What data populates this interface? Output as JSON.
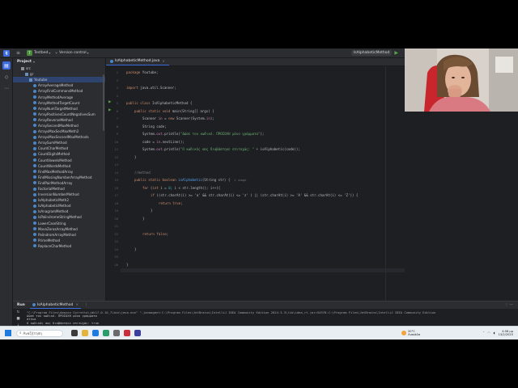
{
  "titlebar": {
    "project_badge": "T",
    "project_name": "Testbed",
    "vcs_label": "Version control",
    "run_config": "IsAlphabeticMethod"
  },
  "project_panel": {
    "title": "Project",
    "items": [
      {
        "label": "src",
        "kind": "folder",
        "indent": 2
      },
      {
        "label": "gr",
        "kind": "pkg",
        "indent": 3
      },
      {
        "label": "Youtube",
        "kind": "pkg",
        "indent": 4,
        "selected": true
      },
      {
        "label": "ArrayAverageMethod",
        "kind": "class",
        "indent": 5
      },
      {
        "label": "ArrayFindCommonsMethod",
        "kind": "class",
        "indent": 5
      },
      {
        "label": "ArrayMethodAverage",
        "kind": "class",
        "indent": 5
      },
      {
        "label": "ArrayMethodTargetCount",
        "kind": "class",
        "indent": 5
      },
      {
        "label": "ArrayNumTargetMethod",
        "kind": "class",
        "indent": 5
      },
      {
        "label": "ArrayPositivesCountNegativesSum",
        "kind": "class",
        "indent": 5
      },
      {
        "label": "ArrayReverseMethod",
        "kind": "class",
        "indent": 5
      },
      {
        "label": "ArraySecondMaxMethod",
        "kind": "class",
        "indent": 5
      },
      {
        "label": "ArraysMaxSecMaxMeth2",
        "kind": "class",
        "indent": 5
      },
      {
        "label": "ArraysMaxSecondMaxMethods",
        "kind": "class",
        "indent": 5
      },
      {
        "label": "ArraySumMethod",
        "kind": "class",
        "indent": 5
      },
      {
        "label": "CountCharMethod",
        "kind": "class",
        "indent": 5
      },
      {
        "label": "CountDigitsMethod",
        "kind": "class",
        "indent": 5
      },
      {
        "label": "CountVowelsMethod",
        "kind": "class",
        "indent": 5
      },
      {
        "label": "CountWordsMethod",
        "kind": "class",
        "indent": 5
      },
      {
        "label": "FindMaxMethodArray",
        "kind": "class",
        "indent": 5
      },
      {
        "label": "FindMissingNumberArrayMethod",
        "kind": "class",
        "indent": 5
      },
      {
        "label": "FindPairMethodArray",
        "kind": "class",
        "indent": 5
      },
      {
        "label": "FactorialMethod",
        "kind": "class",
        "indent": 5
      },
      {
        "label": "InversionNumberMethod",
        "kind": "class",
        "indent": 5
      },
      {
        "label": "IsAlphabeticMeth2",
        "kind": "class",
        "indent": 5
      },
      {
        "label": "IsAlphabeticMethod",
        "kind": "class",
        "indent": 5
      },
      {
        "label": "IsAnagramMethod",
        "kind": "class",
        "indent": 5
      },
      {
        "label": "IsPalindromeStringMethod",
        "kind": "class",
        "indent": 5
      },
      {
        "label": "LowerCaseString",
        "kind": "class",
        "indent": 5
      },
      {
        "label": "MoveZerosArrayMethod",
        "kind": "class",
        "indent": 5
      },
      {
        "label": "PalindromArrayMethod",
        "kind": "class",
        "indent": 5
      },
      {
        "label": "PrimeMethod",
        "kind": "class",
        "indent": 5
      },
      {
        "label": "ReplaceCharMethod",
        "kind": "class",
        "indent": 5
      }
    ]
  },
  "editor": {
    "tab_label": "IsAlphabeticMethod.java",
    "line_numbers": [
      "1",
      "2",
      "3",
      "4",
      "5",
      "6",
      "7",
      "8",
      "9",
      "10",
      "11",
      "12",
      "13",
      "14",
      "15",
      "16",
      "17",
      "18",
      "19",
      "20",
      "21",
      "22",
      "23",
      "24",
      "25",
      "26"
    ],
    "code": {
      "l1_kw": "package",
      "l1_rest": " Youtube;",
      "l3_kw": "import",
      "l3_rest": " java.util.Scanner;",
      "l5_kw": "public class",
      "l5_rest": " IsAlphabeticMethod {",
      "l6_kw": "public static void",
      "l6_rest": " main(String[] args) {",
      "l7_a": "Scanner ",
      "l7_b": "in",
      "l7_c": " = ",
      "l7_kw": "new",
      "l7_d": " Scanner(System.",
      "l7_e": "in",
      "l7_f": ");",
      "l8": "String code;",
      "l9_a": "System.",
      "l9_b": "out",
      "l9_c": ".println(",
      "l9_str": "\"Δώσε τον κωδικό. ΠΡΟΣΟΧΗ μόνο γράμματα\"",
      "l9_d": ");",
      "l10_a": "code = ",
      "l10_b": "in",
      "l10_c": ".nextLine();",
      "l11_a": "System.",
      "l11_b": "out",
      "l11_c": ".println(",
      "l11_str": "\"O κωδικός σας διαβάστηκε επιτυχώς: \"",
      "l11_d": " + isAlphabetic(code));",
      "l12": "}",
      "l14": "//method",
      "l15_kw": "public static boolean",
      "l15_fn": " isAlphabetic",
      "l15_rest": "(String str) {",
      "l15_hint": "1 usage",
      "l16_kw": "for",
      "l16_a": " (",
      "l16_kw2": "int",
      "l16_b": " i = ",
      "l16_n": "0",
      "l16_c": "; i < str.length(); i++){",
      "l17_kw": "if",
      "l17_rest": " ((str.charAt(i) >= 'a' && str.charAt(i) <= 'z' ) || (str.charAt(i) >= 'A' && str.charAt(i) <= 'Z')) {",
      "l18_kw": "return true",
      "l18_rest": ";",
      "l19": "}",
      "l20": "}",
      "l21_kw": "return false",
      "l21_rest": ";",
      "l23": "}",
      "l25": "}"
    }
  },
  "run_panel": {
    "label": "Run",
    "tab_label": "IsAlphabeticMethod",
    "console": [
      "\"C:\\Program Files\\Amazon Corretto\\jdk17.0.10_7\\bin\\java.exe\" \"-javaagent:C:\\Program Files\\JetBrains\\IntelliJ IDEA Community Edition 2024.3.3\\lib\\idea_rt.jar=54978:C:\\Program Files\\JetBrains\\IntelliJ IDEA Community Edition",
      "Δώσε τον κωδικό. ΠΡΟΣΟΧΗ μόνο γράμματα",
      "dthsa",
      "O κωδικός σας διαβάστηκε επιτυχώς: true",
      "",
      "Process finished with exit code 0"
    ]
  },
  "statusbar": {
    "crumbs": [
      "Testbed",
      "src",
      "Youtube",
      "IsAlphabeticMethod"
    ],
    "position": "27:1",
    "line_sep": "CRLF",
    "encoding": "UTF-8",
    "indent": "4 spaces"
  },
  "taskbar": {
    "search_placeholder": "Αναζήτηση",
    "weather_temp": "20°C",
    "weather_desc": "Λιακάδα",
    "time": "4:56 μμ",
    "date": "13/2/2025"
  },
  "colors": {
    "accent": "#3d6ce0",
    "run_green": "#57a64a"
  }
}
